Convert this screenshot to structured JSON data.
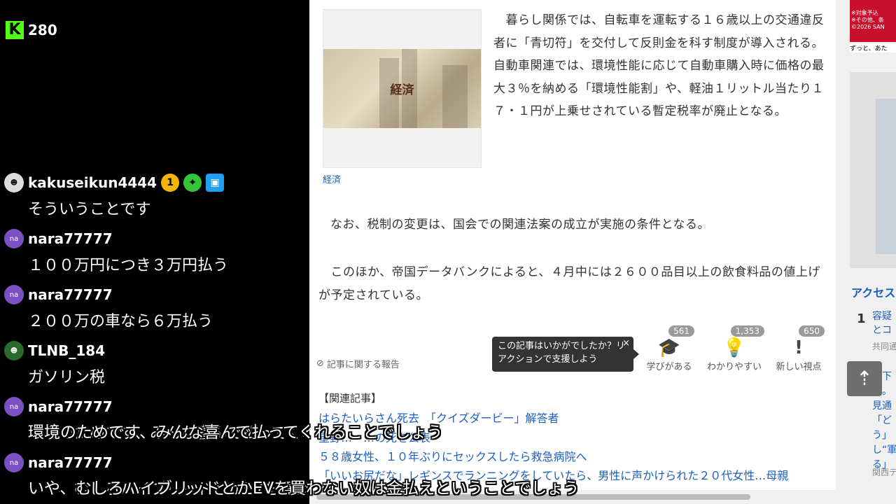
{
  "stream": {
    "viewer_count": "280",
    "logo": "K"
  },
  "chat": [
    {
      "user": "kakuseikun4444",
      "avatar": "",
      "badges": [
        "1",
        "✦",
        "▣"
      ],
      "text": "そういうことです"
    },
    {
      "user": "nara77777",
      "avatar": "na",
      "text": "１００万円につき３万円払う"
    },
    {
      "user": "nara77777",
      "avatar": "na",
      "text": "２００万の車なら６万払う"
    },
    {
      "user": "TLNB_184",
      "avatar": "",
      "text": "ガソリン税"
    },
    {
      "user": "nara77777",
      "avatar": "na",
      "text": "環境のためです、みんな喜んで払ってくれることでしょう"
    },
    {
      "user": "nara77777",
      "avatar": "na",
      "text": "いや、むしろハイブリッドとかEVを買わない奴は金払えということでしょう"
    }
  ],
  "article": {
    "thumb_word": "経済",
    "thumb_caption": "経済",
    "p1": "　暮らし関係では、自転車を運転する１６歳以上の交通違反者に「青切符」を交付して反則金を科す制度が導入される。自動車関連では、環境性能に応じて自動車購入時に価格の最大３％を納める「環境性能割」や、軽油１リットル当たり１７・１円が上乗せされている暫定税率が廃止となる。",
    "p2": "なお、税制の変更は、国会での関連法案の成立が実施の条件となる。",
    "p3": "　このほか、帝国データバンクによると、４月中には２６００品目以上の飲食料品の値上げが予定されている。",
    "report_label": "記事に関する報告",
    "tooltip": "この記事はいかがでしたか？リアクションで支援しよう",
    "tooltip_close": "×",
    "reactions": [
      {
        "count": "561",
        "label": "学びがある",
        "icon": "graduation-cap-icon"
      },
      {
        "count": "1,353",
        "label": "わかりやすい",
        "icon": "lightbulb-icon"
      },
      {
        "count": "650",
        "label": "新しい視点",
        "icon": "exclamation-icon"
      }
    ],
    "related_title": "【関連記事】",
    "related": [
      "はらたいらさん死去　「クイズダービー」解答者",
      "星野…　…の死を公表",
      "５８歳女性、１０年ぶりにセックスしたら救急病院へ",
      "「いいお尻だな」レギンスでランニングをしていたら、男性に声かけられた２０代女性…母親"
    ]
  },
  "rail": {
    "ad_lines": [
      "※対象予込",
      "※その他、条",
      "©2026 SAN"
    ],
    "ad_tag": "ずっと、あた",
    "access_title": "アクセス",
    "rank_number": "1",
    "rank_text": [
      "容疑",
      "とコ"
    ],
    "rank_source": "共同通",
    "rank2_text": [
      "橋下",
      "メ。",
      "見通",
      "「ど",
      "う」",
      "し“軍",
      "る」"
    ],
    "rank2_source": "関西テ",
    "to_top_icon": "⇡"
  },
  "subtitles": [
    "環境のためです、みんな喜んで払ってくれることでしょう",
    "いや、むしろハイブリッドとかEVを買わない奴は金払えということでしょう"
  ]
}
